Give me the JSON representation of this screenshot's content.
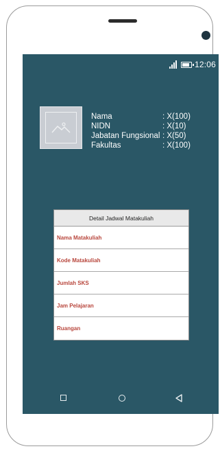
{
  "status_bar": {
    "time": "12:06",
    "signal_icon": "signal-icon",
    "battery_icon": "battery-icon"
  },
  "profile": {
    "avatar_icon": "image-placeholder-icon",
    "fields": [
      {
        "label": "Nama",
        "value": ": X(100)"
      },
      {
        "label": "NIDN",
        "value": ": X(10)"
      },
      {
        "label": "Jabatan Fungsional",
        "value": ": X(50)"
      },
      {
        "label": "Fakultas",
        "value": ": X(100)"
      }
    ]
  },
  "schedule_table": {
    "header": "Detail Jadwal Matakuliah",
    "rows": [
      "Nama Matakuliah",
      "Kode Matakuliah",
      "Jumlah SKS",
      "Jam Pelajaran",
      "Ruangan"
    ]
  },
  "nav_bar": {
    "recent_icon": "square-icon",
    "home_icon": "circle-icon",
    "back_icon": "triangle-back-icon"
  },
  "colors": {
    "screen_bg": "#2a5766",
    "row_text": "#b8463c",
    "header_bg": "#e9e9e9"
  }
}
